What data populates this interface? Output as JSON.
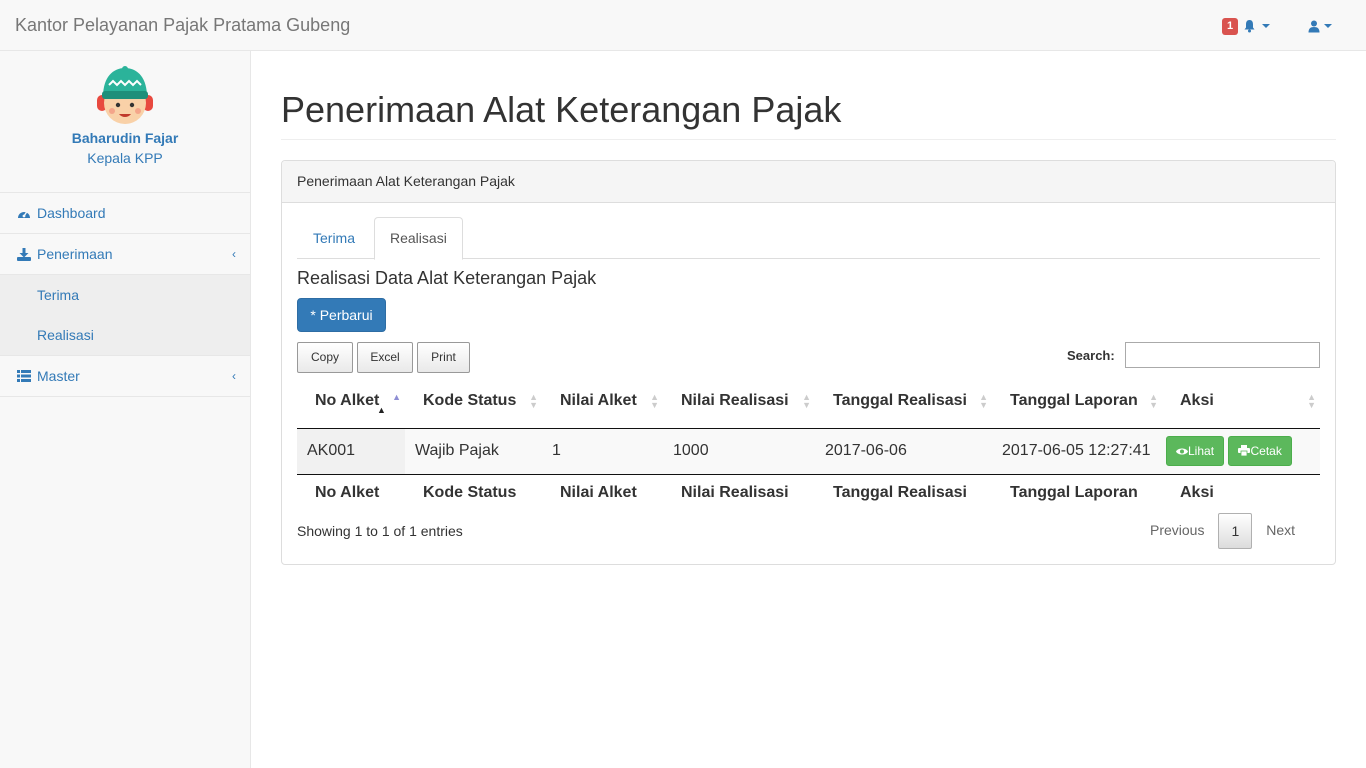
{
  "app": {
    "title": "Kantor Pelayanan Pajak Pratama Gubeng"
  },
  "topbar": {
    "alert_count": "1",
    "alert_icon": "bell-icon",
    "user_icon": "user-icon"
  },
  "user": {
    "name": "Baharudin Fajar",
    "role": "Kepala KPP"
  },
  "sidebar": {
    "items": [
      {
        "label": "Dashboard",
        "icon": "dashboard-icon"
      },
      {
        "label": "Penerimaan",
        "icon": "download-icon",
        "children": [
          {
            "label": "Terima"
          },
          {
            "label": "Realisasi"
          }
        ]
      },
      {
        "label": "Master",
        "icon": "list-icon"
      }
    ]
  },
  "page": {
    "title": "Penerimaan Alat Keterangan Pajak"
  },
  "panel": {
    "heading": "Penerimaan Alat Keterangan Pajak",
    "tabs": [
      {
        "label": "Terima"
      },
      {
        "label": "Realisasi",
        "active": true
      }
    ],
    "section_title": "Realisasi Data Alat Keterangan Pajak",
    "update_button": "* Perbarui"
  },
  "datatable": {
    "buttons": [
      "Copy",
      "Excel",
      "Print"
    ],
    "search_label": "Search:",
    "search_value": "",
    "columns": [
      "No Alket",
      "Kode Status",
      "Nilai Alket",
      "Nilai Realisasi",
      "Tanggal Realisasi",
      "Tanggal Laporan",
      "Aksi"
    ],
    "rows": [
      {
        "no_alket": "AK001",
        "kode_status": "Wajib Pajak",
        "nilai_alket": "1",
        "nilai_realisasi": "1000",
        "tanggal_realisasi": "2017-06-06",
        "tanggal_laporan": "2017-06-05 12:27:41"
      }
    ],
    "actions": {
      "view": "Lihat",
      "print": "Cetak"
    },
    "info": "Showing 1 to 1 of 1 entries",
    "pagination": {
      "previous": "Previous",
      "current": "1",
      "next": "Next"
    }
  }
}
